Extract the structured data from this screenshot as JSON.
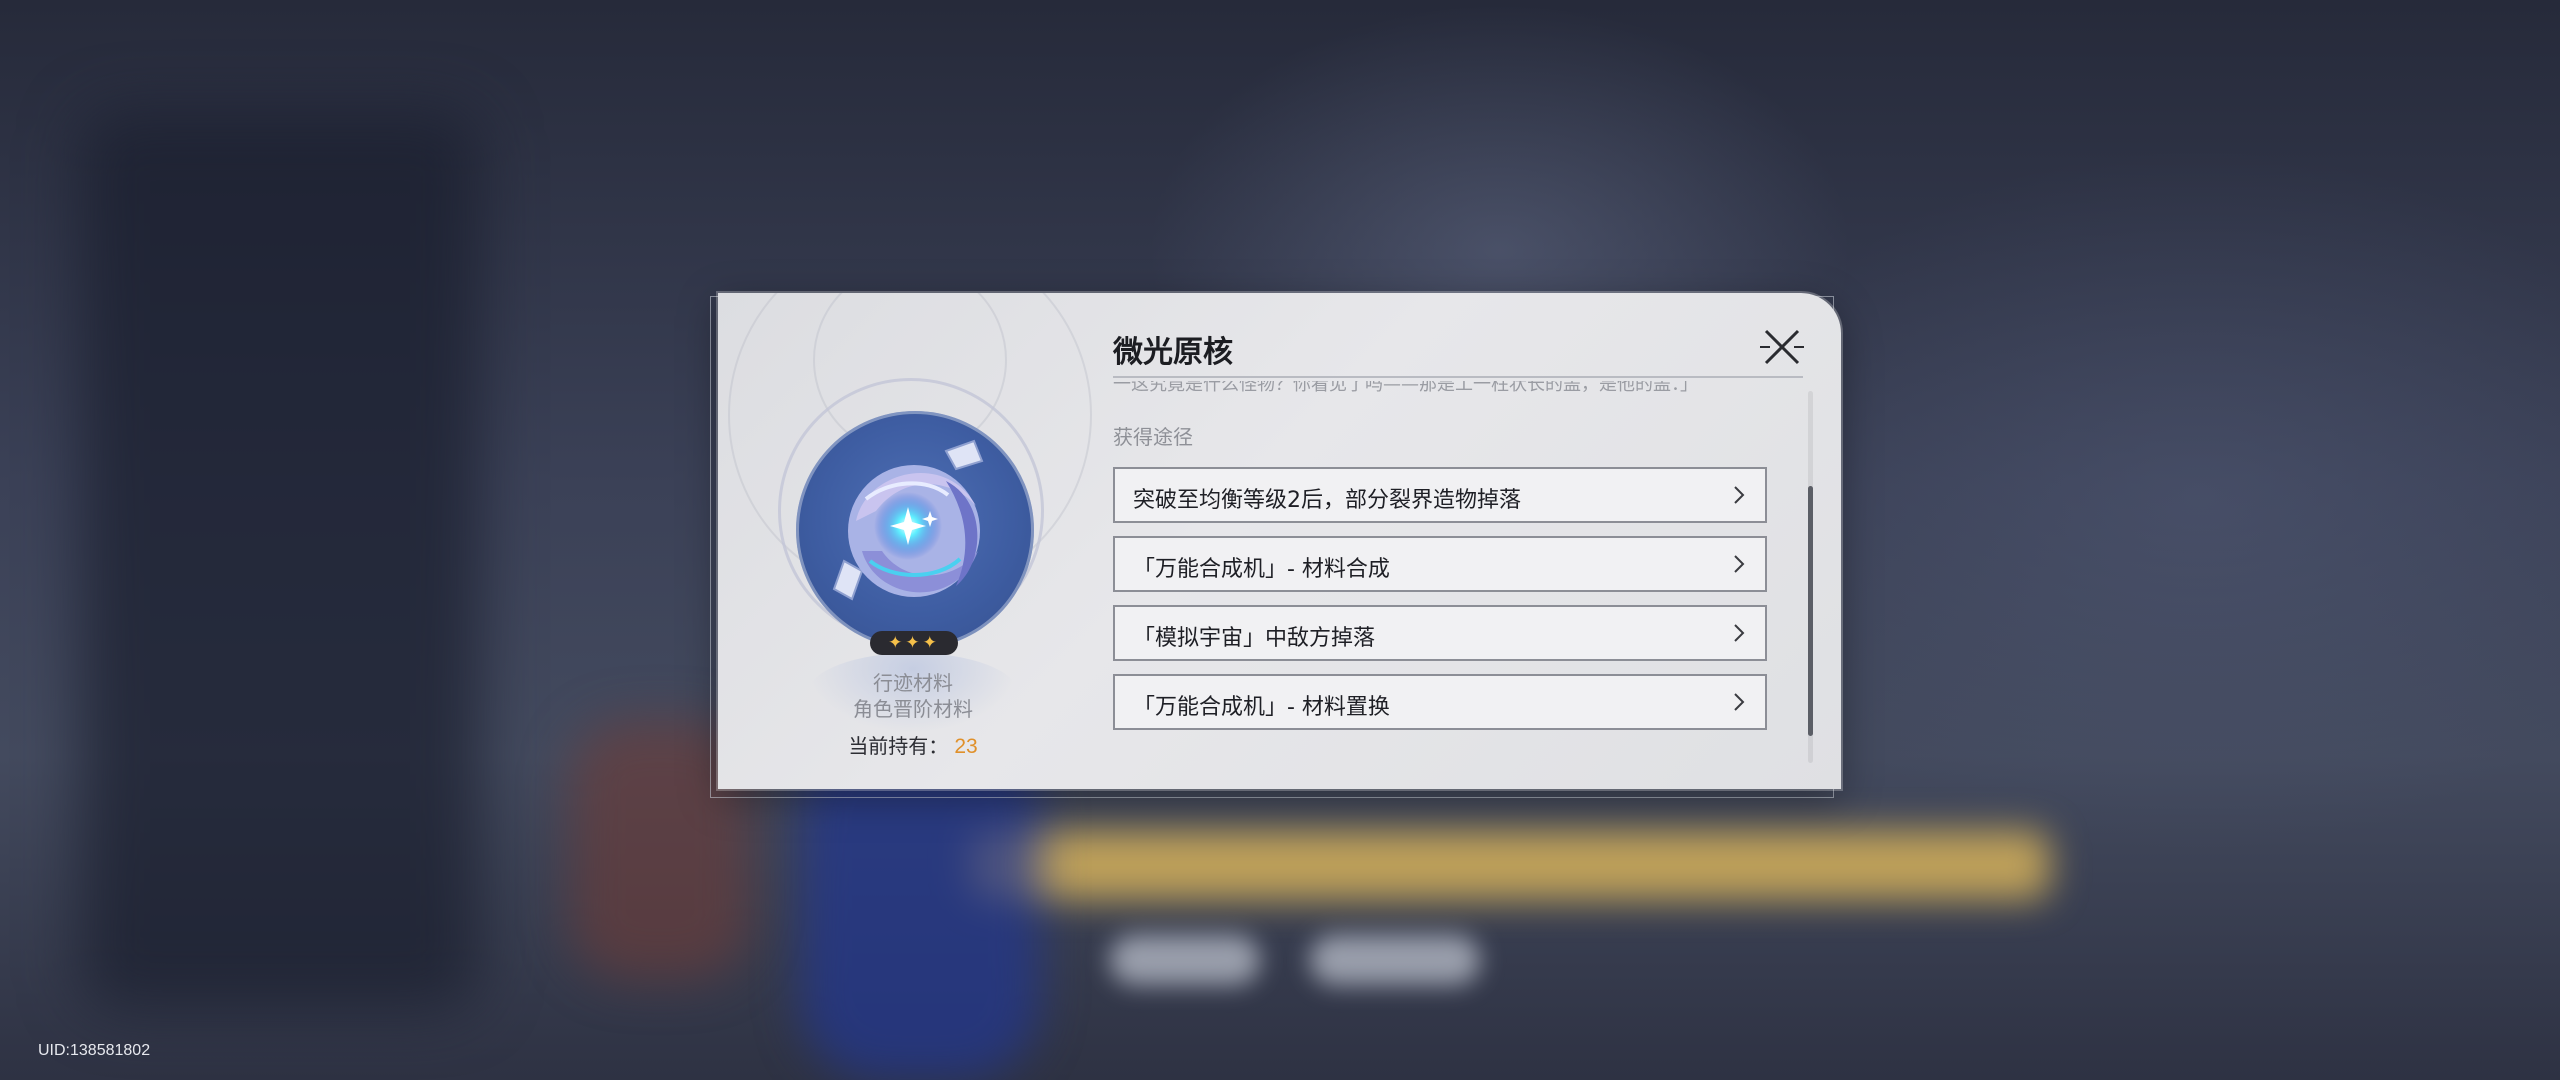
{
  "uid_label": "UID:138581802",
  "item": {
    "name": "微光原核",
    "rarity_stars": "✦✦✦",
    "type_primary": "行迹材料",
    "type_secondary": "角色晋阶材料",
    "owned_label": "当前持有：",
    "owned_count": "23",
    "icon": "glowing-core-icon",
    "description_fragment": "一这究竟是什么怪物？你看见了吗——那是工一柱状长的盖，是他的盖：」"
  },
  "sources": {
    "section_label": "获得途径",
    "items": [
      {
        "label": "突破至均衡等级2后，部分裂界造物掉落"
      },
      {
        "label": "「万能合成机」- 材料合成"
      },
      {
        "label": "「模拟宇宙」中敌方掉落"
      },
      {
        "label": "「万能合成机」- 材料置换"
      }
    ]
  },
  "colors": {
    "accent_count": "#e0902a",
    "star": "#f5c04a",
    "icon_bg": "#3e5da2"
  }
}
